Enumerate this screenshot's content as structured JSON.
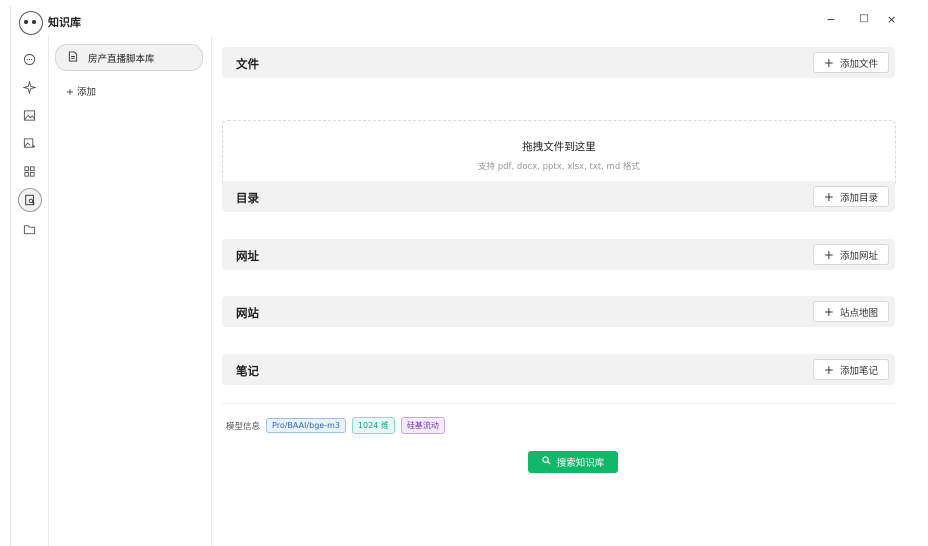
{
  "window": {
    "title": "知识库",
    "controls": [
      "−",
      "□",
      "×"
    ]
  },
  "rail": {
    "icons": [
      "chat-icon",
      "sparkle-icon",
      "image-icon",
      "image-edit-icon",
      "apps-icon",
      "knowledge-icon",
      "folder-icon"
    ],
    "active_index": 5
  },
  "list": {
    "items": [
      {
        "label": "房产直播脚本库"
      }
    ],
    "add_label": "+ 添加"
  },
  "sections": {
    "files": {
      "title": "文件",
      "button": "添加文件"
    },
    "dropzone": {
      "main": "拖拽文件到这里",
      "sub": "支持 pdf, docx, pptx, xlsx, txt, md 格式"
    },
    "directory": {
      "title": "目录",
      "button": "添加目录"
    },
    "url": {
      "title": "网址",
      "button": "添加网址"
    },
    "website": {
      "title": "网站",
      "button": "站点地图"
    },
    "notes": {
      "title": "笔记",
      "button": "添加笔记"
    }
  },
  "model_info": {
    "label": "模型信息",
    "tags": [
      "Pro/BAAI/bge-m3",
      "1024 维",
      "硅基流动"
    ]
  },
  "search_button": "搜索知识库",
  "colors": {
    "accent": "#12b76a"
  }
}
